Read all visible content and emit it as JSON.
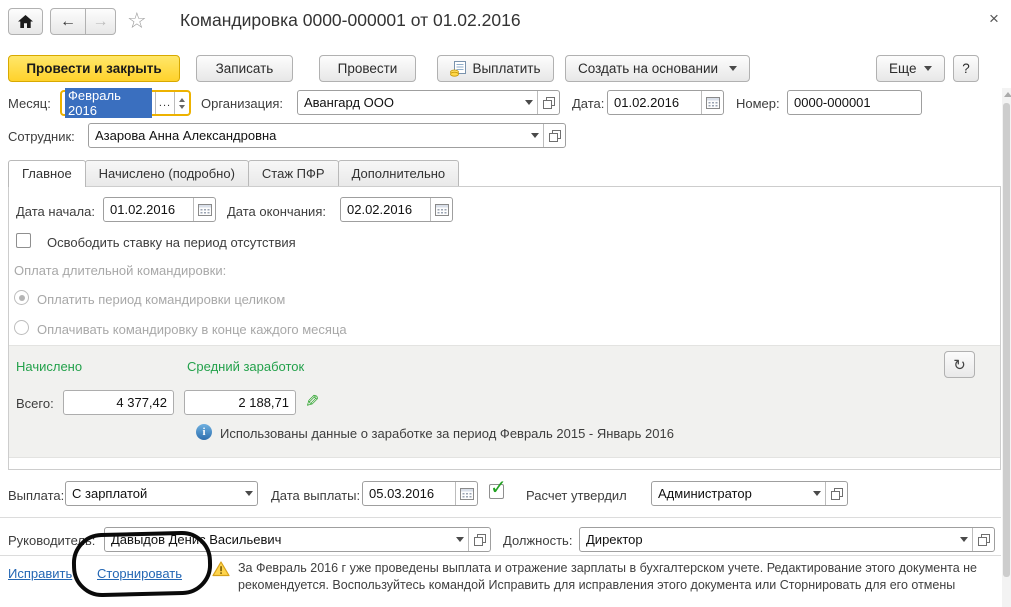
{
  "icons": {
    "back": "←",
    "forward": "→",
    "star": "☆",
    "close": "×",
    "ellipsis": "...",
    "refresh": "↻",
    "pencil": "✎",
    "info_letter": "i",
    "check": "✓"
  },
  "header": {
    "title": "Командировка 0000-000001 от 01.02.2016"
  },
  "toolbar": {
    "post_and_close": "Провести и закрыть",
    "write": "Записать",
    "post": "Провести",
    "pay": "Выплатить",
    "create_on_basis": "Создать на основании",
    "more": "Еще",
    "help": "?"
  },
  "fields": {
    "month": {
      "label": "Месяц:",
      "value": "Февраль 2016"
    },
    "organization": {
      "label": "Организация:",
      "value": "Авангард ООО"
    },
    "date": {
      "label": "Дата:",
      "value": "01.02.2016"
    },
    "number": {
      "label": "Номер:",
      "value": "0000-000001"
    },
    "employee": {
      "label": "Сотрудник:",
      "value": "Азарова Анна Александровна"
    }
  },
  "tabs": [
    {
      "label": "Главное",
      "active": true
    },
    {
      "label": "Начислено (подробно)",
      "active": false
    },
    {
      "label": "Стаж ПФР",
      "active": false
    },
    {
      "label": "Дополнительно",
      "active": false
    }
  ],
  "main_tab": {
    "start_date": {
      "label": "Дата начала:",
      "value": "01.02.2016"
    },
    "end_date": {
      "label": "Дата окончания:",
      "value": "02.02.2016"
    },
    "release_rate_label": "Освободить ставку на период отсутствия",
    "long_trip_section_label": "Оплата длительной командировки:",
    "radio_pay_whole": "Оплатить период командировки целиком",
    "radio_pay_monthly": "Оплачивать командировку в конце каждого месяца",
    "accrued_header": "Начислено",
    "average_header": "Средний заработок",
    "total_label": "Всего:",
    "accrued_total": "4 377,42",
    "average_earnings": "2 188,71",
    "info_message": "Использованы данные о заработке за период Февраль 2015 - Январь 2016"
  },
  "payment_row": {
    "payment": {
      "label": "Выплата:",
      "value": "С зарплатой"
    },
    "payment_date": {
      "label": "Дата выплаты:",
      "value": "05.03.2016"
    },
    "approved": {
      "label": "Расчет утвердил",
      "value": "Администратор"
    }
  },
  "signers_row": {
    "manager": {
      "label": "Руководитель:",
      "value": "Давыдов Денис Васильевич"
    },
    "position": {
      "label": "Должность:",
      "value": "Директор"
    }
  },
  "footer": {
    "fix_link": "Исправить",
    "reverse_link": "Сторнировать",
    "warning_text": "За Февраль 2016 г уже проведены выплата и отражение зарплаты в бухгалтерском учете. Редактирование этого документа не рекомендуется. Воспользуйтесь командой Исправить для исправления этого документа или Сторнировать для его отмены"
  },
  "colors": {
    "primary_button_yellow": "#ffd42e",
    "focused_field_border": "#eeb200",
    "section_green": "#23a14b",
    "link_blue": "#2467b4",
    "selection_blue": "#3a6fbf",
    "warning_yellow": "#ffd54d"
  }
}
